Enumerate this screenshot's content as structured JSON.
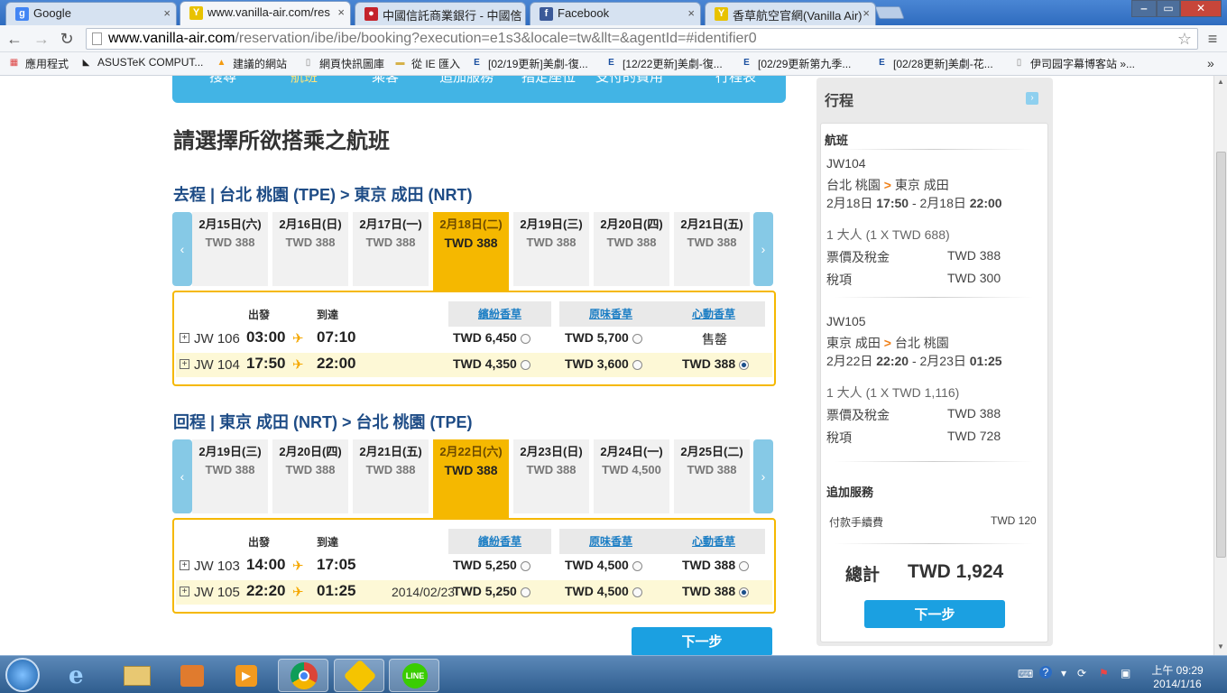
{
  "browser": {
    "tabs": [
      {
        "title": "Google",
        "icon": "google-icon",
        "color": "#4285f4",
        "glyph": "g"
      },
      {
        "title": "www.vanilla-air.com/res",
        "icon": "vanilla-air-icon",
        "color": "#e8c200",
        "glyph": "Y"
      },
      {
        "title": "中國信託商業銀行 - 中國信",
        "icon": "ctbc-icon",
        "color": "#c4232b",
        "glyph": "●"
      },
      {
        "title": "Facebook",
        "icon": "facebook-icon",
        "color": "#3b5998",
        "glyph": "f"
      },
      {
        "title": "香草航空官網(Vanilla Air)",
        "icon": "vanilla-air-icon",
        "color": "#e8c200",
        "glyph": "Y"
      }
    ],
    "url_host": "www.vanilla-air.com",
    "url_rest": "/reservation/ibe/ibe/booking?execution=e1s3&locale=tw&llt=&agentId=#identifier0",
    "bookmarks": [
      "應用程式",
      "ASUSTeK COMPUT...",
      "建議的網站",
      "網頁快訊圖庫",
      "從 IE 匯入",
      "[02/19更新]美劇-復...",
      "[12/22更新]美劇-復...",
      "[02/29更新第九季...",
      "[02/28更新]美劇-花...",
      "伊司园字幕博客站 »..."
    ],
    "more_bookmarks": "»"
  },
  "steps": [
    "搜尋",
    "航班",
    "乘客",
    "追加服務",
    "指定座位",
    "支付的費用",
    "行程表"
  ],
  "page_title": "請選擇所欲搭乘之航班",
  "outbound": {
    "title": "去程 | 台北 桃園 (TPE) > 東京 成田 (NRT)",
    "dates": [
      {
        "d": "2月15日(六)",
        "p": "TWD 388"
      },
      {
        "d": "2月16日(日)",
        "p": "TWD 388"
      },
      {
        "d": "2月17日(一)",
        "p": "TWD 388"
      },
      {
        "d": "2月18日(二)",
        "p": "TWD 388"
      },
      {
        "d": "2月19日(三)",
        "p": "TWD 388"
      },
      {
        "d": "2月20日(四)",
        "p": "TWD 388"
      },
      {
        "d": "2月21日(五)",
        "p": "TWD 388"
      }
    ],
    "selected_date_index": 3,
    "col_depart": "出發",
    "col_arrive": "到達",
    "fare_types": [
      "繽紛香草",
      "原味香草",
      "心動香草"
    ],
    "flights": [
      {
        "no": "JW 106",
        "dep": "03:00",
        "arr": "07:10",
        "arr_date": "",
        "prices": [
          "TWD 6,450",
          "TWD 5,700",
          "售罄"
        ],
        "selected_fare": -1
      },
      {
        "no": "JW 104",
        "dep": "17:50",
        "arr": "22:00",
        "arr_date": "",
        "prices": [
          "TWD 4,350",
          "TWD 3,600",
          "TWD 388"
        ],
        "selected_fare": 2
      }
    ]
  },
  "inbound": {
    "title": "回程 | 東京 成田 (NRT) > 台北 桃園 (TPE)",
    "dates": [
      {
        "d": "2月19日(三)",
        "p": "TWD 388"
      },
      {
        "d": "2月20日(四)",
        "p": "TWD 388"
      },
      {
        "d": "2月21日(五)",
        "p": "TWD 388"
      },
      {
        "d": "2月22日(六)",
        "p": "TWD 388"
      },
      {
        "d": "2月23日(日)",
        "p": "TWD 388"
      },
      {
        "d": "2月24日(一)",
        "p": "TWD 4,500"
      },
      {
        "d": "2月25日(二)",
        "p": "TWD 388"
      }
    ],
    "selected_date_index": 3,
    "col_depart": "出發",
    "col_arrive": "到達",
    "fare_types": [
      "繽紛香草",
      "原味香草",
      "心動香草"
    ],
    "flights": [
      {
        "no": "JW 103",
        "dep": "14:00",
        "arr": "17:05",
        "arr_date": "",
        "prices": [
          "TWD 5,250",
          "TWD 4,500",
          "TWD 388"
        ],
        "selected_fare": -1
      },
      {
        "no": "JW 105",
        "dep": "22:20",
        "arr": "01:25",
        "arr_date": "2014/02/23",
        "prices": [
          "TWD 5,250",
          "TWD 4,500",
          "TWD 388"
        ],
        "selected_fare": 2
      }
    ]
  },
  "next_button": "下一步",
  "sidebar": {
    "title": "行程",
    "flights_header": "航班",
    "leg1": {
      "flight": "JW104",
      "from": "台北 桃園",
      "to": "東京 成田",
      "date_from": "2月18日",
      "time_from": "17:50",
      "dash": "-",
      "date_to": "2月18日",
      "time_to": "22:00",
      "pax": "1 大人 (1 X TWD 688)",
      "fare_label": "票價及稅金",
      "fare_value": "TWD 388",
      "tax_label": "稅項",
      "tax_value": "TWD 300"
    },
    "leg2": {
      "flight": "JW105",
      "from": "東京 成田",
      "to": "台北 桃園",
      "date_from": "2月22日",
      "time_from": "22:20",
      "dash": "-",
      "date_to": "2月23日",
      "time_to": "01:25",
      "pax": "1 大人 (1 X TWD 1,116)",
      "fare_label": "票價及稅金",
      "fare_value": "TWD 388",
      "tax_label": "稅項",
      "tax_value": "TWD 728"
    },
    "extras_header": "追加服務",
    "fee_label": "付款手續費",
    "fee_value": "TWD 120",
    "total_label": "總計",
    "total_value": "TWD 1,924",
    "next_button": "下一步"
  },
  "taskbar": {
    "time": "上午 09:29",
    "date": "2014/1/16"
  },
  "colors": {
    "accent_blue": "#42b4e5",
    "selected_yellow": "#f5b800",
    "button_blue": "#1ba0e1"
  }
}
